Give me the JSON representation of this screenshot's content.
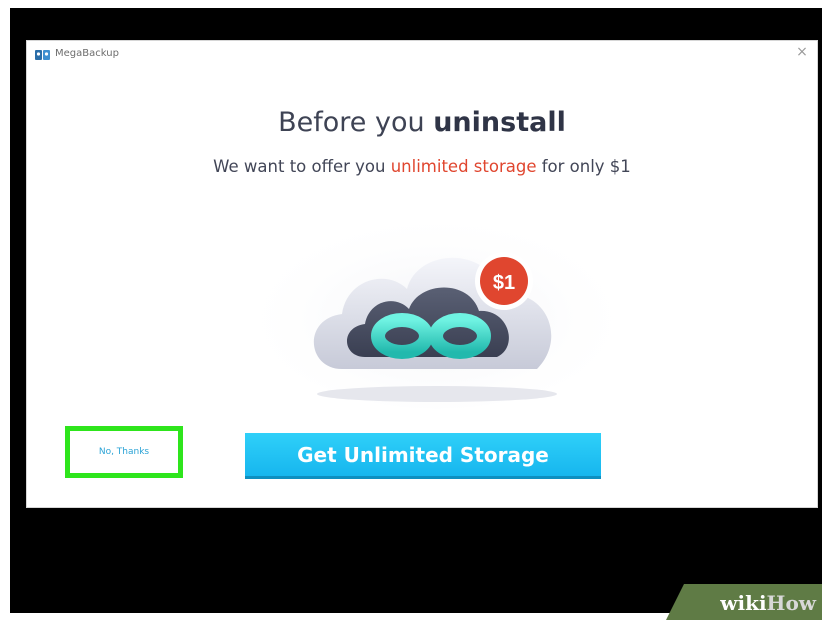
{
  "window": {
    "app_title": "MegaBackup",
    "close_symbol": "×"
  },
  "offer": {
    "heading_prefix": "Before you ",
    "heading_bold": "uninstall",
    "sub_prefix": "We want to offer you ",
    "sub_accent": "unlimited storage",
    "sub_suffix": " for only $1",
    "price_badge": "$1"
  },
  "actions": {
    "decline_label": "No, Thanks",
    "accept_label": "Get Unlimited Storage"
  },
  "brand": {
    "wiki": "wiki",
    "how": "How"
  },
  "colors": {
    "accent_red": "#e0462f",
    "cta_blue": "#1ec3f4",
    "highlight_green": "#2ee51c",
    "link_blue": "#2ba3d6",
    "infinity_teal": "#3fd6c8"
  },
  "icons": {
    "app_logo": "megabackup-logo-icon",
    "close": "close-icon",
    "illustration": "cloud-infinity-icon"
  }
}
